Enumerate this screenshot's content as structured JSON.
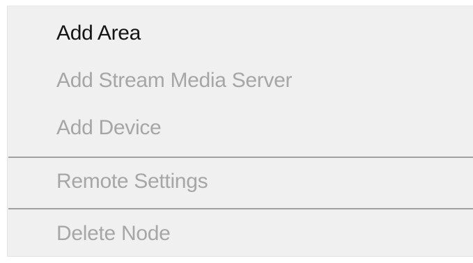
{
  "context_menu": {
    "items": [
      {
        "label": "Add Area",
        "enabled": true
      },
      {
        "label": "Add Stream Media Server",
        "enabled": false
      },
      {
        "label": "Add Device",
        "enabled": false
      },
      {
        "label": "Remote Settings",
        "enabled": false
      },
      {
        "label": "Delete Node",
        "enabled": false
      }
    ],
    "colors": {
      "background": "#f0f0f0",
      "enabled_text": "#141414",
      "disabled_text": "#a6a6a6",
      "separator": "#a0a0a0"
    }
  }
}
